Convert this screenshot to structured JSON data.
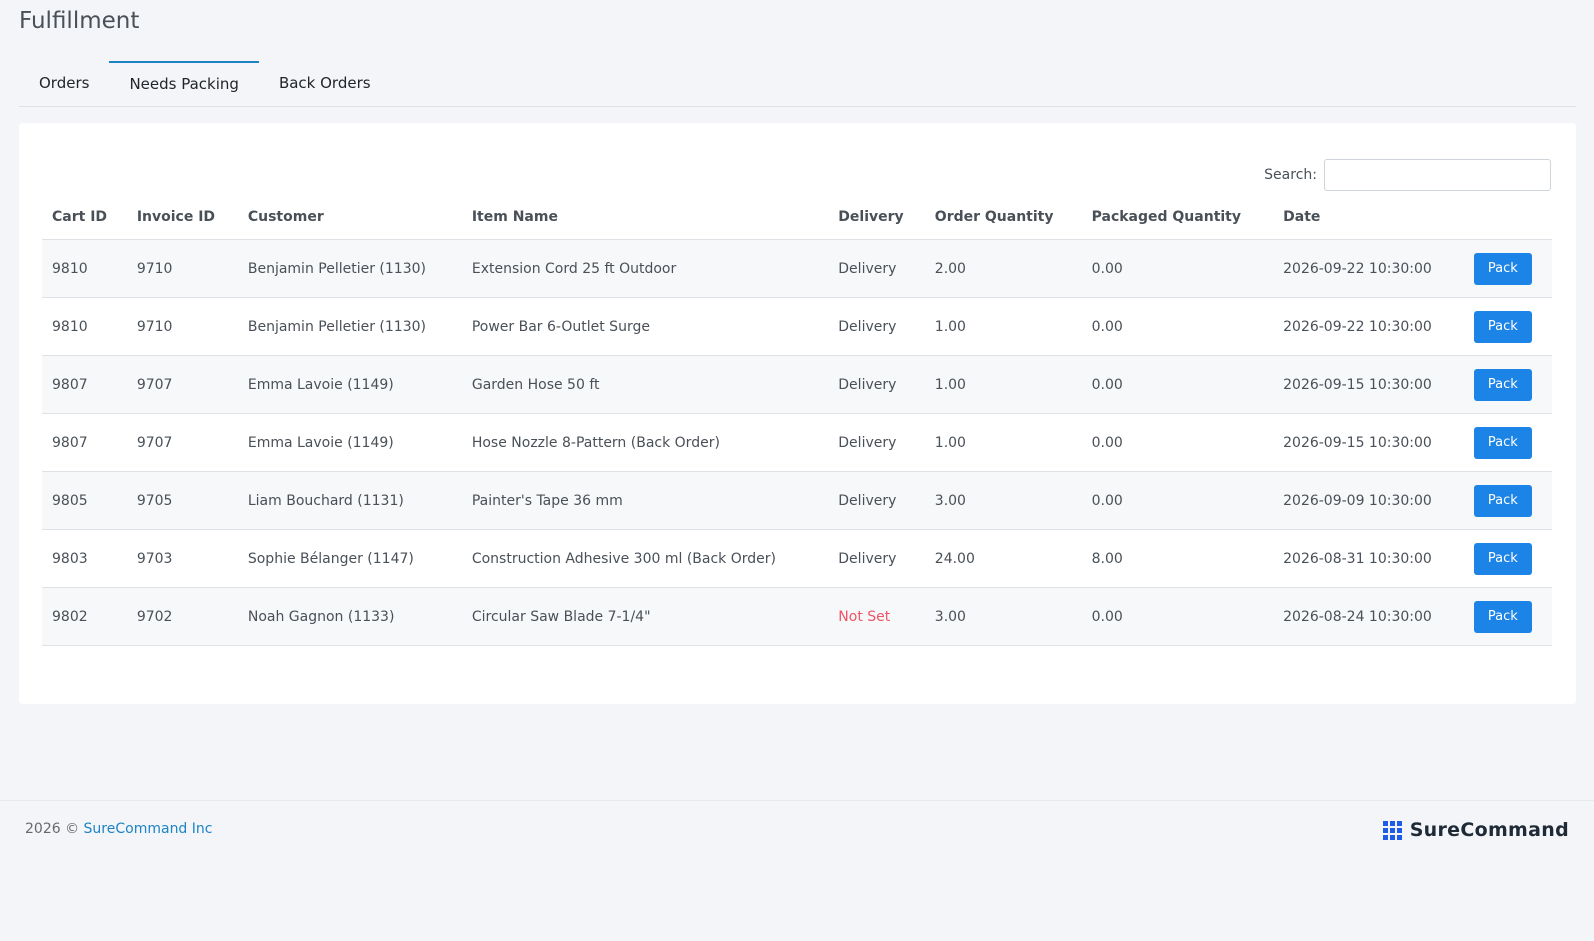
{
  "page": {
    "title": "Fulfillment"
  },
  "tabs": [
    {
      "label": "Orders",
      "active": false
    },
    {
      "label": "Needs Packing",
      "active": true
    },
    {
      "label": "Back Orders",
      "active": false
    }
  ],
  "search": {
    "label": "Search:",
    "value": ""
  },
  "table": {
    "columns": [
      "Cart ID",
      "Invoice ID",
      "Customer",
      "Item Name",
      "Delivery",
      "Order Quantity",
      "Packaged Quantity",
      "Date"
    ],
    "rows": [
      {
        "cart_id": "9810",
        "invoice_id": "9710",
        "customer": "Benjamin Pelletier (1130)",
        "item": "Extension Cord 25 ft Outdoor",
        "delivery": "Delivery",
        "order_qty": "2.00",
        "packaged_qty": "0.00",
        "date": "2026-09-22 10:30:00",
        "action": "Pack"
      },
      {
        "cart_id": "9810",
        "invoice_id": "9710",
        "customer": "Benjamin Pelletier (1130)",
        "item": "Power Bar 6-Outlet Surge",
        "delivery": "Delivery",
        "order_qty": "1.00",
        "packaged_qty": "0.00",
        "date": "2026-09-22 10:30:00",
        "action": "Pack"
      },
      {
        "cart_id": "9807",
        "invoice_id": "9707",
        "customer": "Emma Lavoie (1149)",
        "item": "Garden Hose 50 ft",
        "delivery": "Delivery",
        "order_qty": "1.00",
        "packaged_qty": "0.00",
        "date": "2026-09-15 10:30:00",
        "action": "Pack"
      },
      {
        "cart_id": "9807",
        "invoice_id": "9707",
        "customer": "Emma Lavoie (1149)",
        "item": "Hose Nozzle 8-Pattern (Back Order)",
        "delivery": "Delivery",
        "order_qty": "1.00",
        "packaged_qty": "0.00",
        "date": "2026-09-15 10:30:00",
        "action": "Pack"
      },
      {
        "cart_id": "9805",
        "invoice_id": "9705",
        "customer": "Liam Bouchard (1131)",
        "item": "Painter's Tape 36 mm",
        "delivery": "Delivery",
        "order_qty": "3.00",
        "packaged_qty": "0.00",
        "date": "2026-09-09 10:30:00",
        "action": "Pack"
      },
      {
        "cart_id": "9803",
        "invoice_id": "9703",
        "customer": "Sophie Bélanger (1147)",
        "item": "Construction Adhesive 300 ml (Back Order)",
        "delivery": "Delivery",
        "order_qty": "24.00",
        "packaged_qty": "8.00",
        "date": "2026-08-31 10:30:00",
        "action": "Pack"
      },
      {
        "cart_id": "9802",
        "invoice_id": "9702",
        "customer": "Noah Gagnon (1133)",
        "item": "Circular Saw Blade 7-1/4\"",
        "delivery": "Not Set",
        "order_qty": "3.00",
        "packaged_qty": "0.00",
        "date": "2026-08-24 10:30:00",
        "action": "Pack"
      }
    ]
  },
  "footer": {
    "copyright": "2026 ©",
    "company_link": "SureCommand Inc",
    "brand_name": "SureCommand"
  },
  "colors": {
    "accent": "#1c84e6",
    "not_set": "#ed5565",
    "link": "#1c84c6"
  },
  "icons": {
    "brand_logo": "grid-dots-icon"
  }
}
